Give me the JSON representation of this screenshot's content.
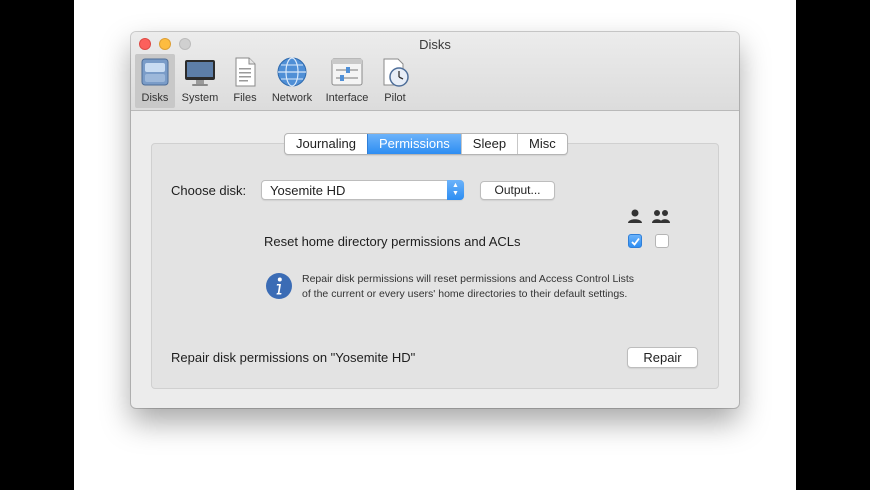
{
  "window": {
    "title": "Disks"
  },
  "toolbar": {
    "items": [
      {
        "label": "Disks",
        "icon": "disks-icon",
        "active": true
      },
      {
        "label": "System",
        "icon": "system-monitor-icon"
      },
      {
        "label": "Files",
        "icon": "files-icon"
      },
      {
        "label": "Network",
        "icon": "network-globe-icon"
      },
      {
        "label": "Interface",
        "icon": "interface-sliders-icon"
      },
      {
        "label": "Pilot",
        "icon": "pilot-clock-icon"
      }
    ]
  },
  "tabs": [
    {
      "label": "Journaling"
    },
    {
      "label": "Permissions",
      "selected": true
    },
    {
      "label": "Sleep"
    },
    {
      "label": "Misc"
    }
  ],
  "permissions": {
    "choose_disk_label": "Choose disk:",
    "disk_selected": "Yosemite HD",
    "output_button": "Output...",
    "column_icons": [
      "single-user-icon",
      "multiple-users-icon"
    ],
    "reset_label": "Reset home directory permissions and ACLs",
    "reset_current_user": true,
    "reset_all_users": false,
    "info_icon": "info-icon",
    "info_line1": "Repair disk permissions will reset permissions and Access Control Lists",
    "info_line2": "of the current or every users' home directories to their default settings.",
    "repair_label": "Repair disk permissions on \"Yosemite HD\"",
    "repair_button": "Repair"
  },
  "colors": {
    "accent": "#2d8df2",
    "close": "#fc605c",
    "minimize": "#fdbc40",
    "zoom_disabled": "#d0d0d0",
    "info_icon": "#3b6cb5"
  }
}
